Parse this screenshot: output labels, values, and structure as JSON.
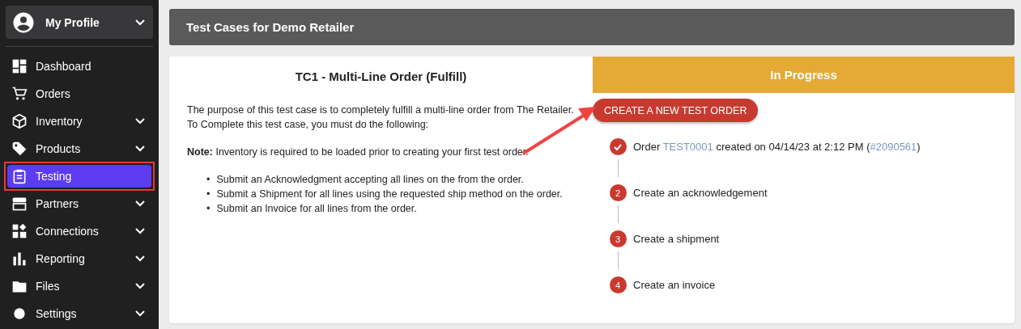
{
  "profile": {
    "name": "My Profile"
  },
  "sidebar": {
    "items": [
      {
        "label": "Dashboard",
        "expandable": false,
        "selected": false,
        "highlighted": false
      },
      {
        "label": "Orders",
        "expandable": false,
        "selected": false,
        "highlighted": false
      },
      {
        "label": "Inventory",
        "expandable": true,
        "selected": false,
        "highlighted": false
      },
      {
        "label": "Products",
        "expandable": true,
        "selected": false,
        "highlighted": false
      },
      {
        "label": "Testing",
        "expandable": false,
        "selected": true,
        "highlighted": true
      },
      {
        "label": "Partners",
        "expandable": true,
        "selected": false,
        "highlighted": false
      },
      {
        "label": "Connections",
        "expandable": true,
        "selected": false,
        "highlighted": false
      },
      {
        "label": "Reporting",
        "expandable": true,
        "selected": false,
        "highlighted": false
      },
      {
        "label": "Files",
        "expandable": true,
        "selected": false,
        "highlighted": false
      },
      {
        "label": "Settings",
        "expandable": true,
        "selected": false,
        "highlighted": false
      }
    ]
  },
  "header": {
    "title": "Test Cases for Demo Retailer"
  },
  "test_case": {
    "title": "TC1 - Multi-Line Order (Fulfill)",
    "description": "The purpose of this test case is to completely fulfill a multi-line order from The Retailer. To Complete this test case, you must do the following:",
    "note": "**Note:** Inventory is required to be loaded prior to creating your first test order.",
    "bullet": "•",
    "tasks": [
      "Submit an Acknowledgment accepting all lines on the from the order.",
      "Submit a Shipment for all lines using the requested ship method on the order.",
      "Submit an Invoice for all lines from the order."
    ]
  },
  "status": {
    "label": "In Progress",
    "color": "#e5a935"
  },
  "create_button": "CREATE A NEW TEST ORDER",
  "steps": [
    {
      "done": true,
      "parts": [
        {
          "kind": "text",
          "text": "Order"
        },
        {
          "kind": "link",
          "text": "TEST0001"
        },
        {
          "kind": "text",
          "text": "created on 04/14/23 at 2:12 PM ("
        },
        {
          "kind": "link",
          "text": "#2090561"
        },
        {
          "kind": "text",
          "text": ")"
        }
      ]
    },
    {
      "done": false,
      "number": "2",
      "parts": [
        {
          "kind": "text",
          "text": "Create an acknowledgement"
        }
      ]
    },
    {
      "done": false,
      "number": "3",
      "parts": [
        {
          "kind": "text",
          "text": "Create a shipment"
        }
      ]
    },
    {
      "done": false,
      "number": "4",
      "parts": [
        {
          "kind": "text",
          "text": "Create an invoice"
        }
      ]
    }
  ]
}
